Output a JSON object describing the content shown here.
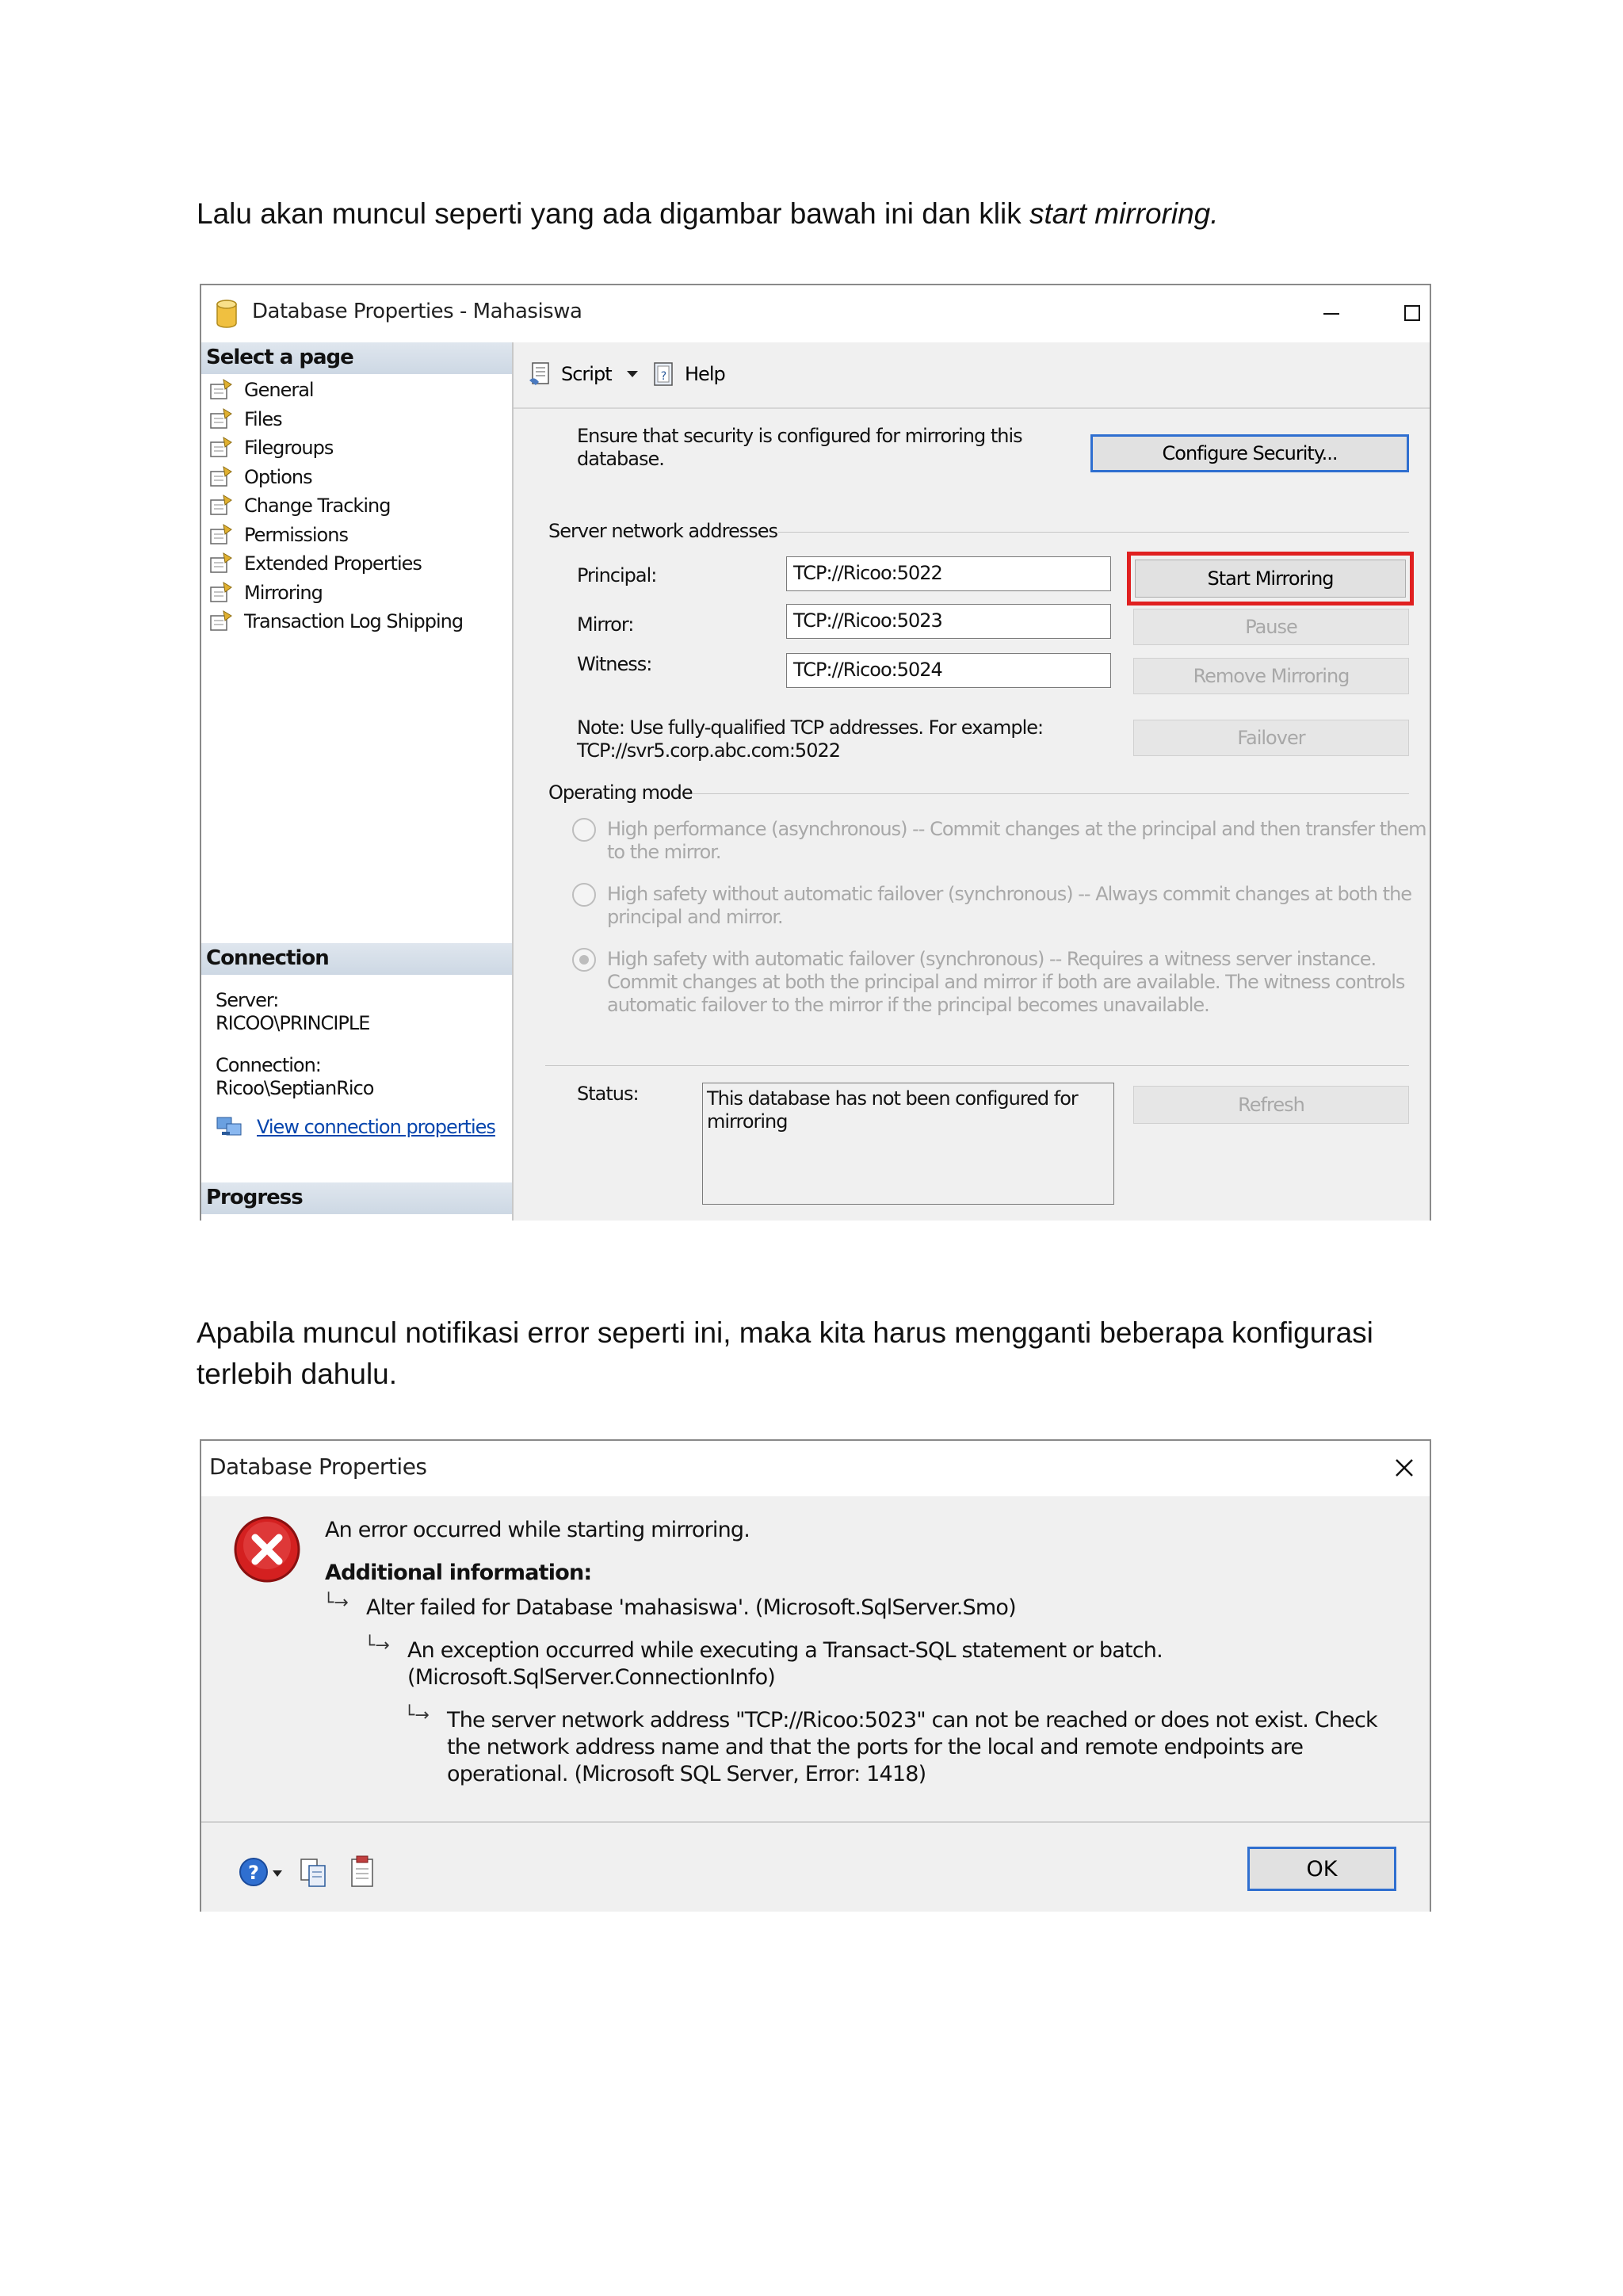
{
  "doc": {
    "para1_text": "Lalu akan muncul seperti yang ada digambar bawah ini dan klik ",
    "para1_italic": "start mirroring.",
    "para2_line1": "Apabila muncul notifikasi error seperti ini, maka kita harus mengganti beberapa konfigurasi",
    "para2_line2": "terlebih dahulu."
  },
  "win1": {
    "title": "Database Properties - Mahasiswa",
    "select_page_header": "Select a page",
    "pages": [
      "General",
      "Files",
      "Filegroups",
      "Options",
      "Change Tracking",
      "Permissions",
      "Extended Properties",
      "Mirroring",
      "Transaction Log Shipping"
    ],
    "connection_header": "Connection",
    "server_label": "Server:",
    "server_value": "RICOO\\PRINCIPLE",
    "connection_label": "Connection:",
    "connection_value": "Ricoo\\SeptianRico",
    "view_conn_props": "View connection properties",
    "progress_header": "Progress",
    "toolbar": {
      "script": "Script",
      "help": "Help"
    },
    "security_text_1": "Ensure that security is configured for mirroring this",
    "security_text_2": "database.",
    "configure_security": "Configure Security...",
    "server_network_addresses": "Server network addresses",
    "principal_label": "Principal:",
    "principal_value": "TCP://Ricoo:5022",
    "mirror_label": "Mirror:",
    "mirror_value": "TCP://Ricoo:5023",
    "witness_label": "Witness:",
    "witness_value": "TCP://Ricoo:5024",
    "start_mirroring": "Start Mirroring",
    "pause": "Pause",
    "remove_mirroring": "Remove Mirroring",
    "failover": "Failover",
    "note_1": "Note: Use fully-qualified TCP addresses. For example:",
    "note_2": "TCP://svr5.corp.abc.com:5022",
    "operating_mode": "Operating mode",
    "mode1_line1": "High performance (asynchronous) -- Commit changes at the principal and then transfer them",
    "mode1_line2": "to the mirror.",
    "mode2_line1": "High safety without automatic failover (synchronous) -- Always commit changes at both the",
    "mode2_line2": "principal and mirror.",
    "mode3_line1": "High safety with automatic failover (synchronous) -- Requires a witness server instance.",
    "mode3_line2": "Commit changes at both the principal and mirror if both are available. The witness controls",
    "mode3_line3": "automatic failover to the mirror if the principal becomes unavailable.",
    "status_label": "Status:",
    "status_line1": "This database has not been configured for",
    "status_line2": "mirroring",
    "refresh": "Refresh"
  },
  "win2": {
    "title": "Database Properties",
    "error_main": "An error occurred while starting mirroring.",
    "additional_info": "Additional information:",
    "err1": "Alter failed for Database 'mahasiswa'.  (Microsoft.SqlServer.Smo)",
    "err2_line1": "An exception occurred while executing a Transact-SQL statement or batch.",
    "err2_line2": "(Microsoft.SqlServer.ConnectionInfo)",
    "err3_line1": "The server network address \"TCP://Ricoo:5023\" can not be reached or does not exist. Check",
    "err3_line2": "the network address name and that the ports for the local and remote endpoints are",
    "err3_line3": "operational. (Microsoft SQL Server, Error: 1418)",
    "ok": "OK"
  },
  "colors": {
    "highlight": "#e02020",
    "link": "#0645ad",
    "error_red": "#d42020"
  }
}
